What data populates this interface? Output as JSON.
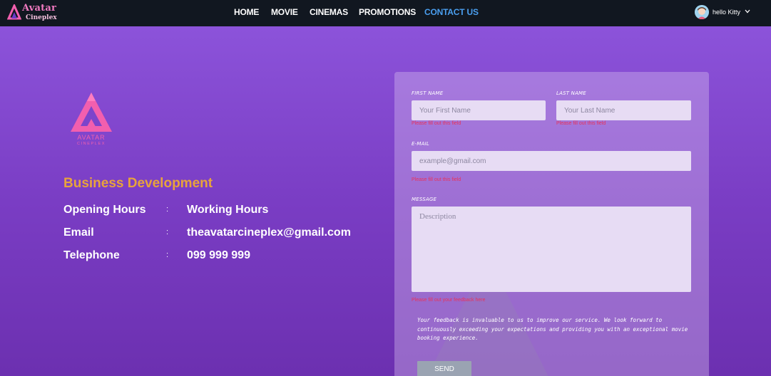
{
  "brand": {
    "name": "Avatar",
    "sub": "Cineplex"
  },
  "nav": {
    "items": [
      {
        "label": "HOME",
        "active": false
      },
      {
        "label": "MOVIE",
        "active": false
      },
      {
        "label": "CINEMAS",
        "active": false
      },
      {
        "label": "PROMOTIONS",
        "active": false
      },
      {
        "label": "CONTACT US",
        "active": true
      }
    ]
  },
  "user": {
    "name": "hello Kitty"
  },
  "logo": {
    "line1": "AVATAR",
    "line2": "CINEPLEX"
  },
  "info": {
    "title": "Business Development",
    "rows": [
      {
        "label": "Opening Hours",
        "sep": ":",
        "value": "Working Hours"
      },
      {
        "label": "Email",
        "sep": ":",
        "value": "theavatarcineplex@gmail.com"
      },
      {
        "label": "Telephone",
        "sep": ":",
        "value": "099 999 999"
      }
    ]
  },
  "form": {
    "first_name": {
      "label": "FIRST NAME",
      "placeholder": "Your First Name",
      "value": "",
      "error": "Please fill out this field"
    },
    "last_name": {
      "label": "LAST NAME",
      "placeholder": "Your Last Name",
      "value": "",
      "error": "Please fill out this field"
    },
    "email": {
      "label": "E-MAIL",
      "placeholder": "example@gmail.com",
      "value": "",
      "error": "Please fill out this field"
    },
    "message": {
      "label": "MESSAGE",
      "placeholder": "Description",
      "value": "",
      "error": "Please fill out your feedback here"
    },
    "note": "Your feedback is invaluable to us to improve our service. We look forward to continuously exceeding your expectations and providing you with an exceptional movie booking experience.",
    "send_label": "SEND"
  },
  "colors": {
    "nav_bg": "#111720",
    "nav_active": "#4a9ff0",
    "accent_orange": "#e8a33c",
    "brand_pink": "#f25fae",
    "error": "#e8325a",
    "page_bg_top": "#8c53da",
    "page_bg_bottom": "#6c30b0"
  },
  "icons": {
    "brand": "avatar-triangle-logo",
    "avatar": "user-avatar",
    "dropdown": "chevron-down-icon"
  }
}
